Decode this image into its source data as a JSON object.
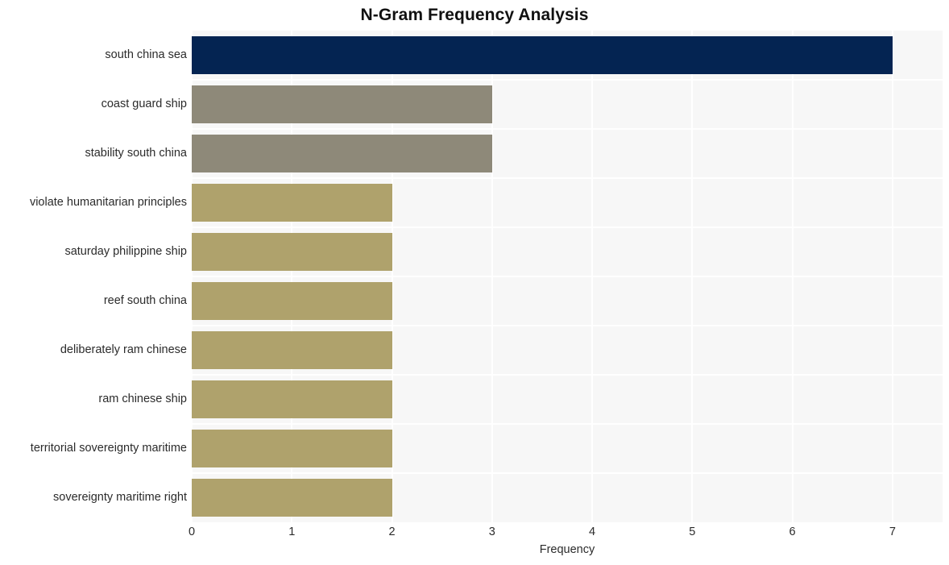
{
  "chart_data": {
    "type": "bar",
    "orientation": "horizontal",
    "title": "N-Gram Frequency Analysis",
    "xlabel": "Frequency",
    "ylabel": "",
    "xlim": [
      0,
      7.5
    ],
    "xticks": [
      0,
      1,
      2,
      3,
      4,
      5,
      6,
      7
    ],
    "xtick_labels": [
      "0",
      "1",
      "2",
      "3",
      "4",
      "5",
      "6",
      "7"
    ],
    "grid": true,
    "legend": "none",
    "categories": [
      "south china sea",
      "coast guard ship",
      "stability south china",
      "violate humanitarian principles",
      "saturday philippine ship",
      "reef south china",
      "deliberately ram chinese",
      "ram chinese ship",
      "territorial sovereignty maritime",
      "sovereignty maritime right"
    ],
    "values": [
      7,
      3,
      3,
      2,
      2,
      2,
      2,
      2,
      2,
      2
    ],
    "bar_colors": [
      "#042452",
      "#8e8979",
      "#8e8979",
      "#afa26c",
      "#afa26c",
      "#afa26c",
      "#afa26c",
      "#afa26c",
      "#afa26c",
      "#afa26c"
    ]
  },
  "style": {
    "plot_background": "#f7f7f7",
    "gridline_color": "#ffffff",
    "page_background": "#ffffff",
    "text_color": "#2b2b2b",
    "title_color": "#111111"
  }
}
